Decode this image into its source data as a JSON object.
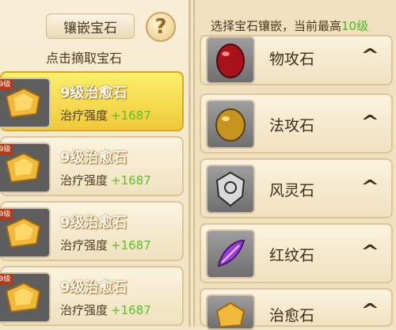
{
  "left": {
    "title": "镶嵌宝石",
    "help": "?",
    "hint": "点击摘取宝石",
    "items": [
      {
        "tag": "9级",
        "name": "9级治愈石",
        "stat_label": "治疗强度",
        "stat_value": "+1687"
      },
      {
        "tag": "9级",
        "name": "9级治愈石",
        "stat_label": "治疗强度",
        "stat_value": "+1687"
      },
      {
        "tag": "9级",
        "name": "9级治愈石",
        "stat_label": "治疗强度",
        "stat_value": "+1687"
      },
      {
        "tag": "9级",
        "name": "9级治愈石",
        "stat_label": "治疗强度",
        "stat_value": "+1687"
      }
    ]
  },
  "right": {
    "title_prefix": "选择宝石镶嵌，当前最高",
    "title_level": "10级",
    "types": [
      {
        "name": "物攻石",
        "icon": "red-gem-icon",
        "chevron": "^"
      },
      {
        "name": "法攻石",
        "icon": "amber-gem-icon",
        "chevron": "^"
      },
      {
        "name": "风灵石",
        "icon": "shield-gem-icon",
        "chevron": "^"
      },
      {
        "name": "红纹石",
        "icon": "purple-feather-icon",
        "chevron": "^"
      },
      {
        "name": "治愈石",
        "icon": "gold-gem-icon",
        "chevron": "^"
      }
    ]
  },
  "colors": {
    "accent_green": "#57c12a",
    "selected_bg": "#f0c93a",
    "panel_bg": "#f3e6c8"
  }
}
